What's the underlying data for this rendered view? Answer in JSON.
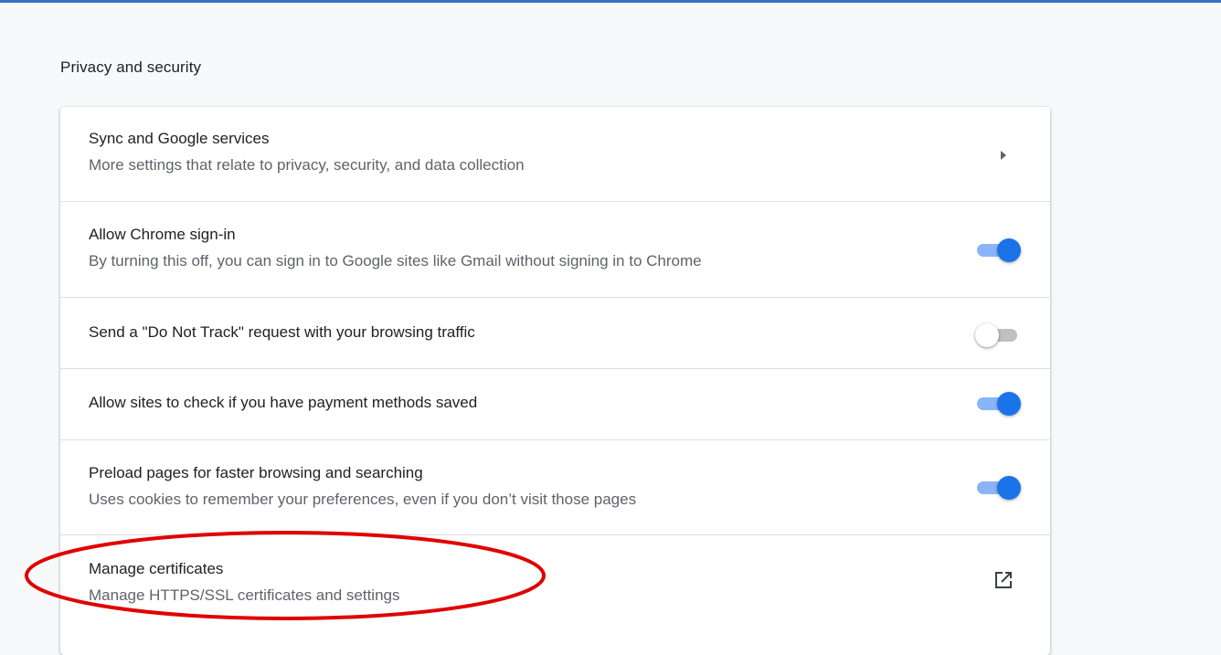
{
  "section": {
    "title": "Privacy and security"
  },
  "rows": [
    {
      "primary": "Sync and Google services",
      "secondary": "More settings that relate to privacy, security, and data collection",
      "control": "arrow-right-icon"
    },
    {
      "primary": "Allow Chrome sign-in",
      "secondary": "By turning this off, you can sign in to Google sites like Gmail without signing in to Chrome",
      "control": "toggle",
      "checked": true
    },
    {
      "primary": "Send a \"Do Not Track\" request with your browsing traffic",
      "control": "toggle",
      "checked": false
    },
    {
      "primary": "Allow sites to check if you have payment methods saved",
      "control": "toggle",
      "checked": true
    },
    {
      "primary": "Preload pages for faster browsing and searching",
      "secondary": "Uses cookies to remember your preferences, even if you don’t visit those pages",
      "control": "toggle",
      "checked": true
    },
    {
      "primary": "Manage certificates",
      "secondary": "Manage HTTPS/SSL certificates and settings",
      "control": "open-in-new-icon"
    }
  ],
  "colors": {
    "accent": "#1a73e8",
    "accent_track": "#8ab4f8",
    "annotation": "#e00000",
    "top_rule": "#3c6fc4"
  }
}
